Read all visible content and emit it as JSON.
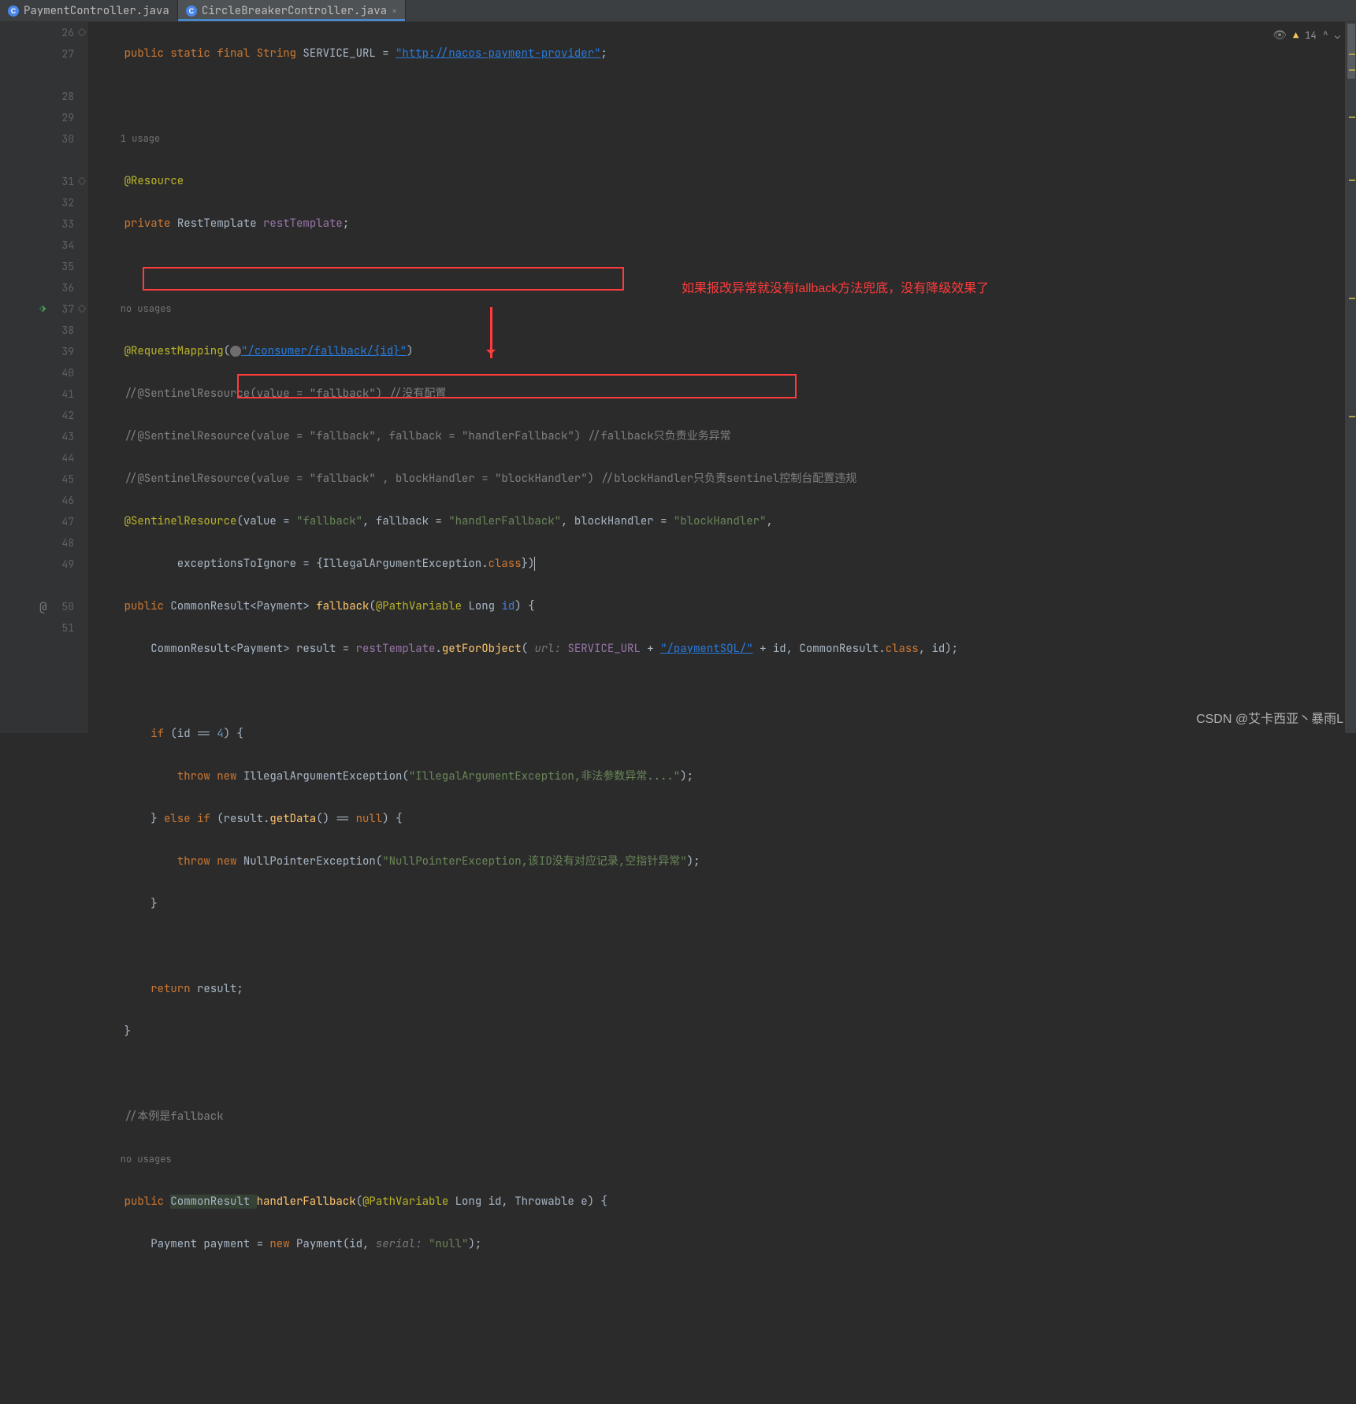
{
  "tabs": [
    {
      "label": "PaymentController.java"
    },
    {
      "label": "CircleBreakerController.java"
    }
  ],
  "gutter_lines": [
    "26",
    "27",
    "",
    "28",
    "29",
    "30",
    "",
    "31",
    "32",
    "33",
    "34",
    "35",
    "36",
    "37",
    "38",
    "39",
    "40",
    "41",
    "42",
    "43",
    "44",
    "45",
    "46",
    "47",
    "48",
    "49",
    "",
    "50",
    "51"
  ],
  "status": {
    "warnings": "14",
    "chev": "^"
  },
  "code": {
    "l26_pre": "    public static final String ",
    "l26_id": "SERVICE_URL",
    "l26_eq": " = ",
    "l26_str": "\"http://nacos-payment-provider\"",
    "l26_end": ";",
    "l_usage1": "    1 usage",
    "l28": "    @Resource",
    "l29_pre": "    private ",
    "l29_type": "RestTemplate ",
    "l29_field": "restTemplate",
    "l29_end": ";",
    "l_usage2": "    no usages",
    "l31_ann": "    @RequestMapping",
    "l31_open": "(",
    "l31_val": "\"/consumer/fallback/{id}\"",
    "l31_close": ")",
    "l32": "    //@SentinelResource(value = \"fallback\") //没有配置",
    "l33": "    //@SentinelResource(value = \"fallback\", fallback = \"handlerFallback\") //fallback只负责业务异常",
    "l34": "    //@SentinelResource(value = \"fallback\" , blockHandler = \"blockHandler\") //blockHandler只负责sentinel控制台配置违规",
    "l35_a": "    @SentinelResource",
    "l35_b": "(value = ",
    "l35_c": "\"fallback\"",
    "l35_d": ", fallback = ",
    "l35_e": "\"handlerFallback\"",
    "l35_f": ", blockHandler = ",
    "l35_g": "\"blockHandler\"",
    "l35_h": ",",
    "l36_a": "            exceptionsToIgnore = {IllegalArgumentException.",
    "l36_b": "class",
    "l36_c": "})",
    "l37_a": "    public ",
    "l37_b": "CommonResult<Payment> ",
    "l37_c": "fallback",
    "l37_d": "(",
    "l37_e": "@PathVariable ",
    "l37_f": "Long ",
    "l37_g": "id",
    "l37_h": ") {",
    "l38_a": "        CommonResult<Payment> result = ",
    "l38_b": "restTemplate",
    "l38_c": ".",
    "l38_d": "getForObject",
    "l38_e": "( ",
    "l38_hint": "url: ",
    "l38_f": "SERVICE_URL ",
    "l38_g": "+ ",
    "l38_h": "\"/paymentSQL/\"",
    "l38_i": " + id, CommonResult.",
    "l38_j": "class",
    "l38_k": ", id);",
    "l40_a": "        if ",
    "l40_b": "(id == ",
    "l40_c": "4",
    "l40_d": ") {",
    "l41_a": "            throw new ",
    "l41_b": "IllegalArgumentException(",
    "l41_c": "\"IllegalArgumentException,非法参数异常....\"",
    "l41_d": ");",
    "l42_a": "        } ",
    "l42_b": "else if ",
    "l42_c": "(result.",
    "l42_d": "getData",
    "l42_e": "() == ",
    "l42_f": "null",
    "l42_g": ") {",
    "l43_a": "            throw new ",
    "l43_b": "NullPointerException(",
    "l43_c": "\"NullPointerException,该ID没有对应记录,空指针异常\"",
    "l43_d": ");",
    "l44": "        }",
    "l46_a": "        return ",
    "l46_b": "result;",
    "l47": "    }",
    "l49": "    //本例是fallback",
    "l_usage3": "    no usages",
    "l50_a": "    public ",
    "l50_b": "CommonResult ",
    "l50_c": "handlerFallback",
    "l50_d": "(",
    "l50_e": "@PathVariable ",
    "l50_f": "Long id, Throwable e) {",
    "l51_a": "        Payment payment = ",
    "l51_b": "new ",
    "l51_c": "Payment(id, ",
    "l51_hint": "serial: ",
    "l51_d": "\"null\"",
    "l51_e": ");"
  },
  "annotation": "如果报改异常就没有fallback方法兜底，没有降级效果了",
  "watermark": "CSDN @艾卡西亚丶暴雨L"
}
